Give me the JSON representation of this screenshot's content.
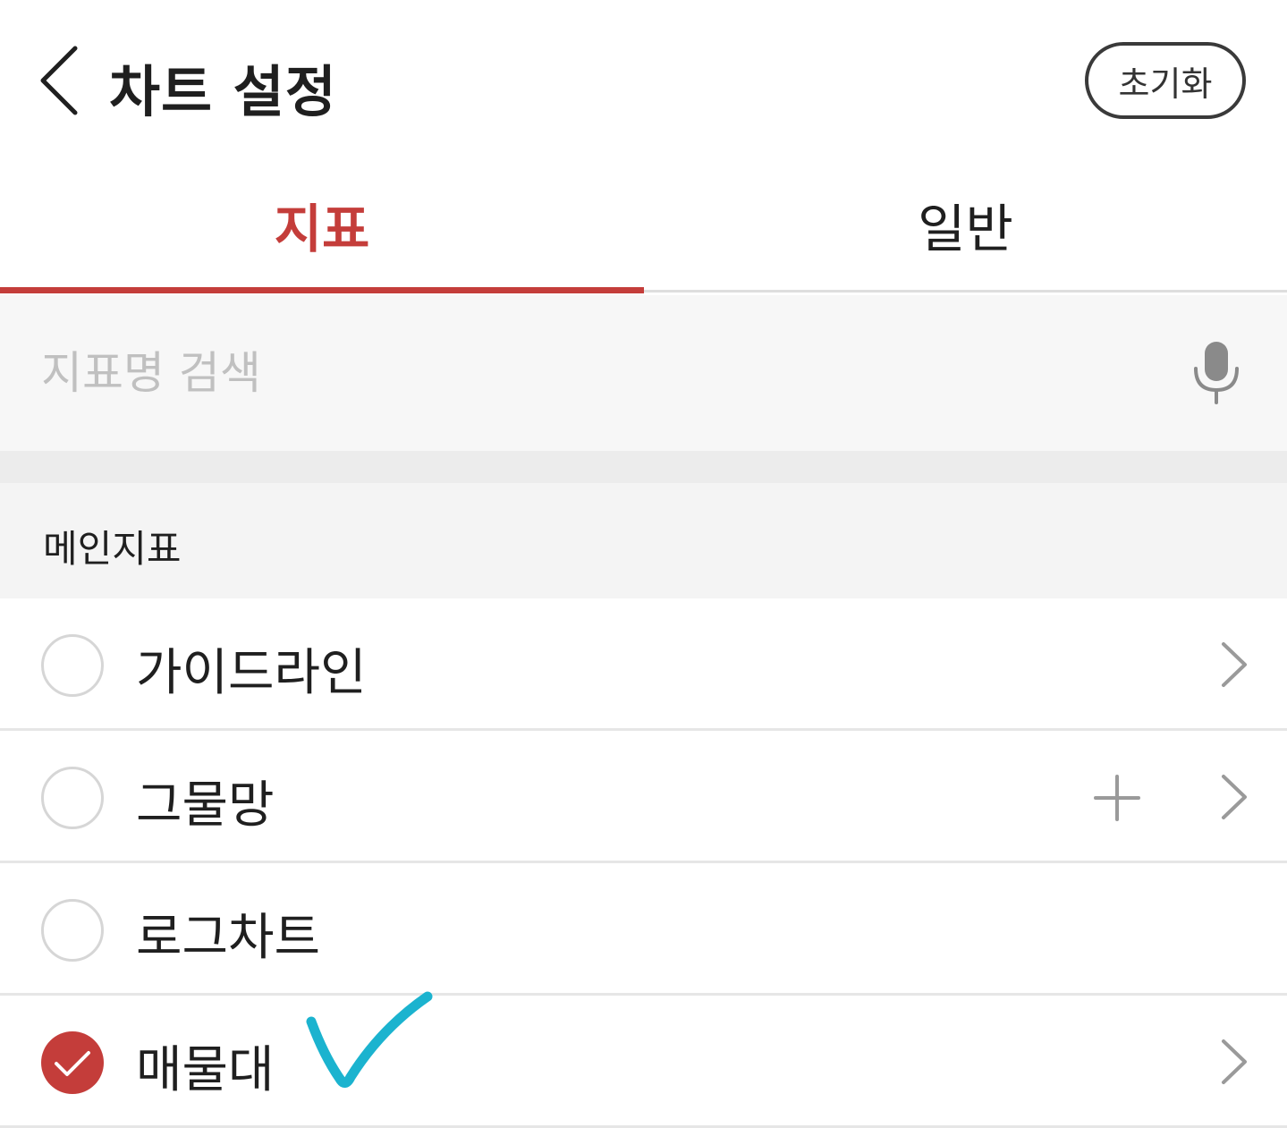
{
  "header": {
    "title": "차트 설정",
    "reset_label": "초기화"
  },
  "tabs": [
    {
      "label": "지표",
      "selected": true
    },
    {
      "label": "일반",
      "selected": false
    }
  ],
  "search": {
    "placeholder": "지표명 검색",
    "value": ""
  },
  "section": {
    "title": "메인지표",
    "items": [
      {
        "label": "가이드라인",
        "checked": false,
        "has_add": false,
        "has_detail": true
      },
      {
        "label": "그물망",
        "checked": false,
        "has_add": true,
        "has_detail": true
      },
      {
        "label": "로그차트",
        "checked": false,
        "has_add": false,
        "has_detail": false
      },
      {
        "label": "매물대",
        "checked": true,
        "has_add": false,
        "has_detail": true
      }
    ]
  },
  "colors": {
    "accent": "#c43d3a",
    "annotation": "#1bb3cf"
  },
  "icons": {
    "back": "back-chevron-icon",
    "mic": "microphone-icon",
    "detail": "chevron-right-icon",
    "add": "plus-icon",
    "checked": "check-circle-icon"
  }
}
